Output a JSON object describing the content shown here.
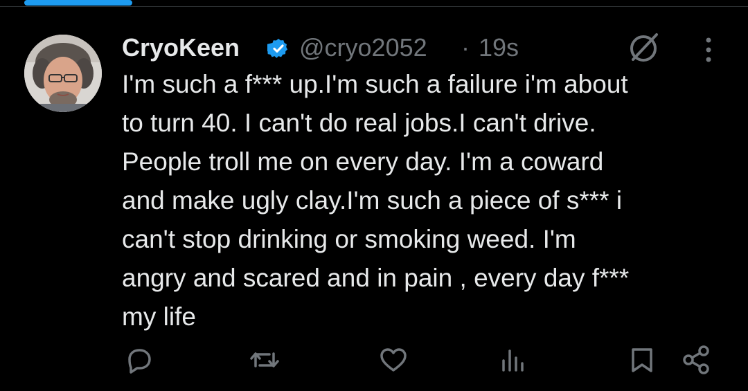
{
  "user": {
    "display_name": "CryoKeen",
    "handle": "@cryo2052",
    "separator": "·",
    "timestamp": "19s",
    "verified": true
  },
  "tweet": {
    "lines": [
      "I'm such a f*** up.I'm such a failure i'm about",
      "to turn 40. I can't do real jobs.I can't drive.",
      "People troll me on every day. I'm a coward",
      "and make ugly clay.I'm such a piece of s*** i",
      "can't stop drinking or smoking weed. I'm",
      "angry and scared and in pain , every day f***",
      "my life"
    ]
  },
  "icons": {
    "verified": "verified-badge-icon",
    "grok": "grok-icon",
    "more": "more-vertical-icon",
    "reply": "reply-icon",
    "repost": "repost-icon",
    "like": "like-icon",
    "views": "views-icon",
    "bookmark": "bookmark-icon",
    "share": "share-icon"
  },
  "colors": {
    "background": "#000000",
    "text": "#e7e9ea",
    "muted": "#71767b",
    "accent": "#1d9bf0"
  }
}
